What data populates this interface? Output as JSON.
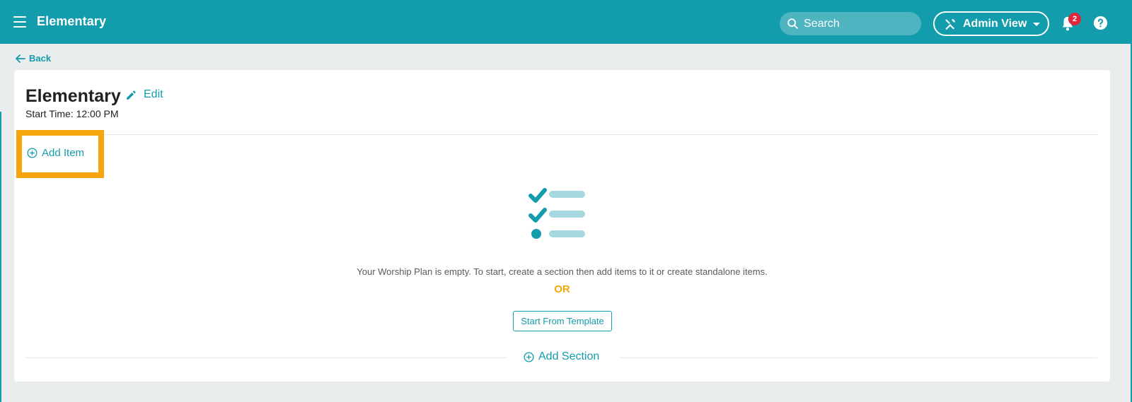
{
  "header": {
    "app_title": "Elementary",
    "menu_icon": "hamburger-menu-icon",
    "search_placeholder": "Search",
    "admin_view_label": "Admin View",
    "notification_count": "2",
    "help_icon": "help-icon"
  },
  "nav": {
    "back_label": "Back"
  },
  "plan": {
    "title": "Elementary",
    "edit_label": "Edit",
    "start_time": "Start Time: 12:00 PM",
    "add_item_label": "Add Item",
    "empty_message": "Your Worship Plan is empty. To start, create a section then add items to it or create standalone items.",
    "or_label": "OR",
    "template_button_label": "Start From Template",
    "add_section_label": "Add Section"
  },
  "colors": {
    "brand": "#139cab",
    "accent": "#f6a50c",
    "badge": "#e0263b"
  }
}
